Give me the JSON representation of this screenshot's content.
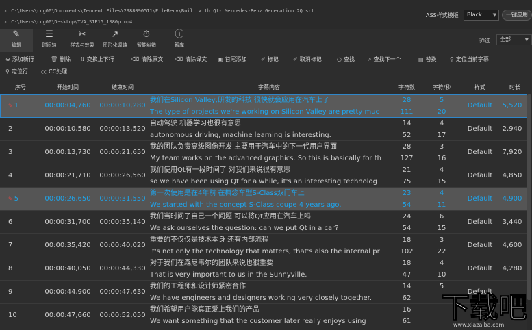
{
  "files": [
    {
      "path": "C:\\Users\\ccg00\\Documents\\Tencent Files\\2988090511\\FileRecv\\Built with Qt- Mercedes-Benz Generation 2Q.srt"
    },
    {
      "path": "C:\\Users\\ccg00\\Desktop\\TVA_S1E15_1080p.mp4"
    }
  ],
  "header": {
    "ass_label": "ASS样式模版",
    "ass_value": "Black",
    "onekey_label": "一键应用"
  },
  "toolbar": {
    "tools": [
      {
        "label": "编辑",
        "icon": "pencil-icon"
      },
      {
        "label": "时间轴",
        "icon": "timeline-icon"
      },
      {
        "label": "样式与效果",
        "icon": "effects-icon"
      },
      {
        "label": "图形化调轴",
        "icon": "graph-icon"
      },
      {
        "label": "智能纠错",
        "icon": "stopwatch-icon"
      },
      {
        "label": "智库",
        "icon": "lightbulb-icon"
      }
    ],
    "filter_label": "筛选",
    "filter_value": "全部"
  },
  "actions": [
    {
      "label": "添加新行",
      "icon": "plus-circle-icon"
    },
    {
      "label": "删除",
      "icon": "trash-icon"
    },
    {
      "label": "交换上下行",
      "icon": "swap-icon"
    },
    {
      "label": "清除原文",
      "icon": "eraser-icon"
    },
    {
      "label": "清除译文",
      "icon": "eraser-icon"
    },
    {
      "label": "首尾添加",
      "icon": "box-icon"
    },
    {
      "label": "标记",
      "icon": "pin-icon"
    },
    {
      "label": "取消标记",
      "icon": "pin-icon"
    },
    {
      "label": "查找",
      "icon": "search-icon"
    },
    {
      "label": "查找下一个",
      "icon": "search-icon"
    },
    {
      "label": "替换",
      "icon": "replace-icon"
    },
    {
      "label": "定位当前字幕",
      "icon": "location-icon"
    },
    {
      "label": "定位行",
      "icon": "location-icon"
    },
    {
      "label": "CC处理",
      "icon": "cc-icon"
    }
  ],
  "table": {
    "columns": [
      "序号",
      "开始时间",
      "结束时间",
      "字幕内容",
      "字符数",
      "字符/秒",
      "样式",
      "时长"
    ],
    "rows": [
      {
        "no": "1",
        "marked": true,
        "start": "00:00:04,760",
        "end": "00:00:10,280",
        "zh": "我们在Silicon Valley,研发的科技  很快就会应用在汽车上了",
        "en": "The type of projects we're working on Silicon Valley are pretty muc",
        "c1": "28",
        "c2": "111",
        "r1": "5",
        "r2": "20",
        "style": "Default",
        "dur": "5,520"
      },
      {
        "no": "2",
        "marked": false,
        "start": "00:00:10,580",
        "end": "00:00:13,520",
        "zh": "自动驾驶  机器学习也很有意思",
        "en": "autonomous driving, machine learning is interesting.",
        "c1": "14",
        "c2": "52",
        "r1": "4",
        "r2": "17",
        "style": "Default",
        "dur": "2,940"
      },
      {
        "no": "3",
        "marked": false,
        "start": "00:00:13,730",
        "end": "00:00:21,650",
        "zh": "我的团队负责高级图像开发  主要用于汽车中的下一代用户界面",
        "en": "My team works on the advanced graphics. So this is basically for th",
        "c1": "28",
        "c2": "127",
        "r1": "3",
        "r2": "16",
        "style": "Default",
        "dur": "7,920"
      },
      {
        "no": "4",
        "marked": false,
        "start": "00:00:21,710",
        "end": "00:00:26,560",
        "zh": "我们使用Qt有一段时间了  对我们来说很有意思",
        "en": "so we have been using Qt for a while, it's an interesting technolog",
        "c1": "21",
        "c2": "75",
        "r1": "4",
        "r2": "15",
        "style": "Default",
        "dur": "4,850"
      },
      {
        "no": "5",
        "marked": true,
        "start": "00:00:26,650",
        "end": "00:00:31,550",
        "zh": "第一次使用是在4年前  在概念车型S-Class双门车上",
        "en": "We started with the concept S-Class coupe 4 years ago.",
        "c1": "23",
        "c2": "54",
        "r1": "4",
        "r2": "11",
        "style": "Default",
        "dur": "4,900"
      },
      {
        "no": "6",
        "marked": false,
        "start": "00:00:31,700",
        "end": "00:00:35,140",
        "zh": "我们当时问了自己一个问题  可以将Qt应用在汽车上吗",
        "en": "We ask ourselves the question: can we put Qt in a car?",
        "c1": "24",
        "c2": "54",
        "r1": "6",
        "r2": "15",
        "style": "Default",
        "dur": "3,440"
      },
      {
        "no": "7",
        "marked": false,
        "start": "00:00:35,420",
        "end": "00:00:40,020",
        "zh": "重要的不仅仅是技术本身  还有内部流程",
        "en": "It's not only the technology that matters, that's also the internal pr",
        "c1": "18",
        "c2": "102",
        "r1": "3",
        "r2": "22",
        "style": "Default",
        "dur": "4,600"
      },
      {
        "no": "8",
        "marked": false,
        "start": "00:00:40,050",
        "end": "00:00:44,330",
        "zh": "对于我们在森尼韦尔的团队来说也很重要",
        "en": "That is very important to us in the Sunnyville.",
        "c1": "18",
        "c2": "47",
        "r1": "4",
        "r2": "10",
        "style": "Default",
        "dur": "4,280"
      },
      {
        "no": "9",
        "marked": false,
        "start": "00:00:44,900",
        "end": "00:00:47,630",
        "zh": "我们的工程师和设计师紧密合作",
        "en": "We have engineers and designers working very closely together.",
        "c1": "14",
        "c2": "62",
        "r1": "5",
        "r2": "",
        "style": "Default",
        "dur": ""
      },
      {
        "no": "10",
        "marked": false,
        "start": "00:00:47,660",
        "end": "00:00:52,050",
        "zh": "我们希望用户能真正爱上我们的产品",
        "en": "We want something that the customer later really enjoys using",
        "c1": "16",
        "c2": "61",
        "r1": "",
        "r2": "",
        "style": "",
        "dur": ""
      }
    ]
  },
  "watermark": {
    "logo_text": "下载吧",
    "site": "www.xiazaiba.com"
  }
}
